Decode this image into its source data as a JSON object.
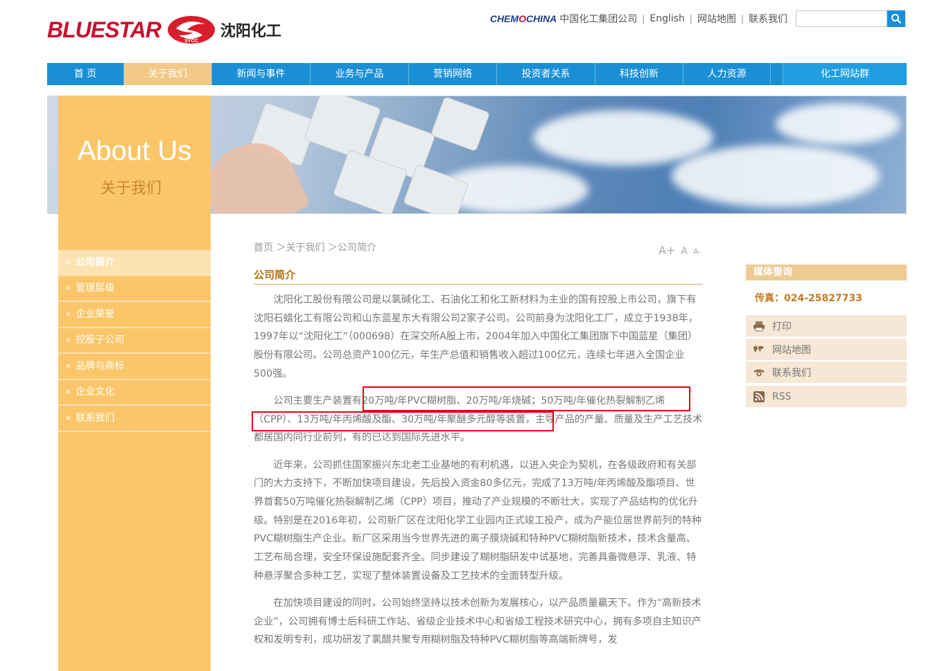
{
  "header": {
    "brand": "BLUESTAR",
    "logo_badge": "SYCC",
    "company_cn": "沈阳化工",
    "chemchina": {
      "prefix": "CHEM",
      "o": "O",
      "suffix": "CHINA"
    },
    "links": [
      "中国化工集团公司",
      "English",
      "网站地图",
      "联系我们"
    ],
    "search_placeholder": ""
  },
  "nav": {
    "items": [
      "首  页",
      "关于我们",
      "新闻与事件",
      "业务与产品",
      "营销网络",
      "投资者关系",
      "科技创新",
      "人力资源",
      "化工网站群"
    ],
    "active": "关于我们"
  },
  "left": {
    "title_en": "About Us",
    "title_cn": "关于我们",
    "menu": [
      {
        "arrow": ">",
        "label": "公司简介",
        "active": true
      },
      {
        "arrow": "×",
        "label": "管理层级"
      },
      {
        "arrow": "×",
        "label": "企业荣誉"
      },
      {
        "arrow": "×",
        "label": "控股子公司"
      },
      {
        "arrow": "×",
        "label": "品牌与商标"
      },
      {
        "arrow": "×",
        "label": "企业文化"
      },
      {
        "arrow": "×",
        "label": "联系我们"
      }
    ]
  },
  "content": {
    "breadcrumb": "首页 ＞关于我们 ＞公司简介",
    "font_sizes": [
      "A+",
      "A",
      "A-"
    ],
    "section_title": "公司简介",
    "paragraphs": [
      "沈阳化工股份有限公司是以氯碱化工、石油化工和化工新材料为主业的国有控股上市公司，旗下有沈阳石蜡化工有限公司和山东蓝星东大有限公司2家子公司。公司前身为沈阳化工厂，成立于1938年，1997年以“沈阳化工”（000698）在深交所A股上市，2004年加入中国化工集团旗下中国蓝星（集团）股份有限公司。公司总资产100亿元，年生产总值和销售收入超过100亿元，连续七年进入全国企业500强。",
      "公司主要生产装置有20万吨/年PVC糊树脂、20万吨/年烧碱；50万吨/年催化热裂解制乙烯（CPP）、13万吨/年丙烯酸及酯、30万吨/年聚醚多元醇等装置，主导产品的产量、质量及生产工艺技术都居国内同行业前列，有的已达到国际先进水平。",
      "近年来，公司抓住国家振兴东北老工业基地的有利机遇，以进入央企为契机，在各级政府和有关部门的大力支持下，不断加快项目建设，先后投入资金80多亿元，完成了13万吨/年丙烯酸及酯项目、世界首套50万吨催化热裂解制乙烯（CPP）项目，推动了产业规模的不断壮大，实现了产品结构的优化升级。特别是在2016年初，公司新厂区在沈阳化学工业园内正式竣工投产，成为产能位居世界前列的特种PVC糊树脂生产企业。新厂区采用当今世界先进的离子膜烧碱和特种PVC糊树脂新技术，技术含量高、工艺布局合理，安全环保设施配套齐全。同步建设了糊树脂研发中试基地，完善具备微悬浮、乳液、特种悬浮聚合多种工艺，实现了整体装置设备及工艺技术的全面转型升级。",
      "在加快项目建设的同时，公司始终坚持以技术创新为发展核心，以产品质量赢天下。作为“高新技术企业”，公司拥有博士后科研工作站、省级企业技术中心和省级工程技术研究中心，拥有多项自主知识产权和发明专利，成功研发了氯醋共聚专用糊树脂及特种PVC糊树脂等高端新牌号，发"
    ]
  },
  "right": {
    "media_title": "媒体垂询",
    "fax": "传真：024-25827733",
    "links": [
      {
        "icon": "printer-icon",
        "label": "打印"
      },
      {
        "icon": "world-map-icon",
        "label": "网站地图"
      },
      {
        "icon": "phone-icon",
        "label": "联系我们"
      },
      {
        "icon": "rss-icon",
        "label": "RSS"
      }
    ]
  },
  "colors": {
    "nav_blue": "#1a8fd6",
    "orange": "#fbc66a",
    "accent": "#b06f12",
    "highlight_red": "#e3001b"
  }
}
